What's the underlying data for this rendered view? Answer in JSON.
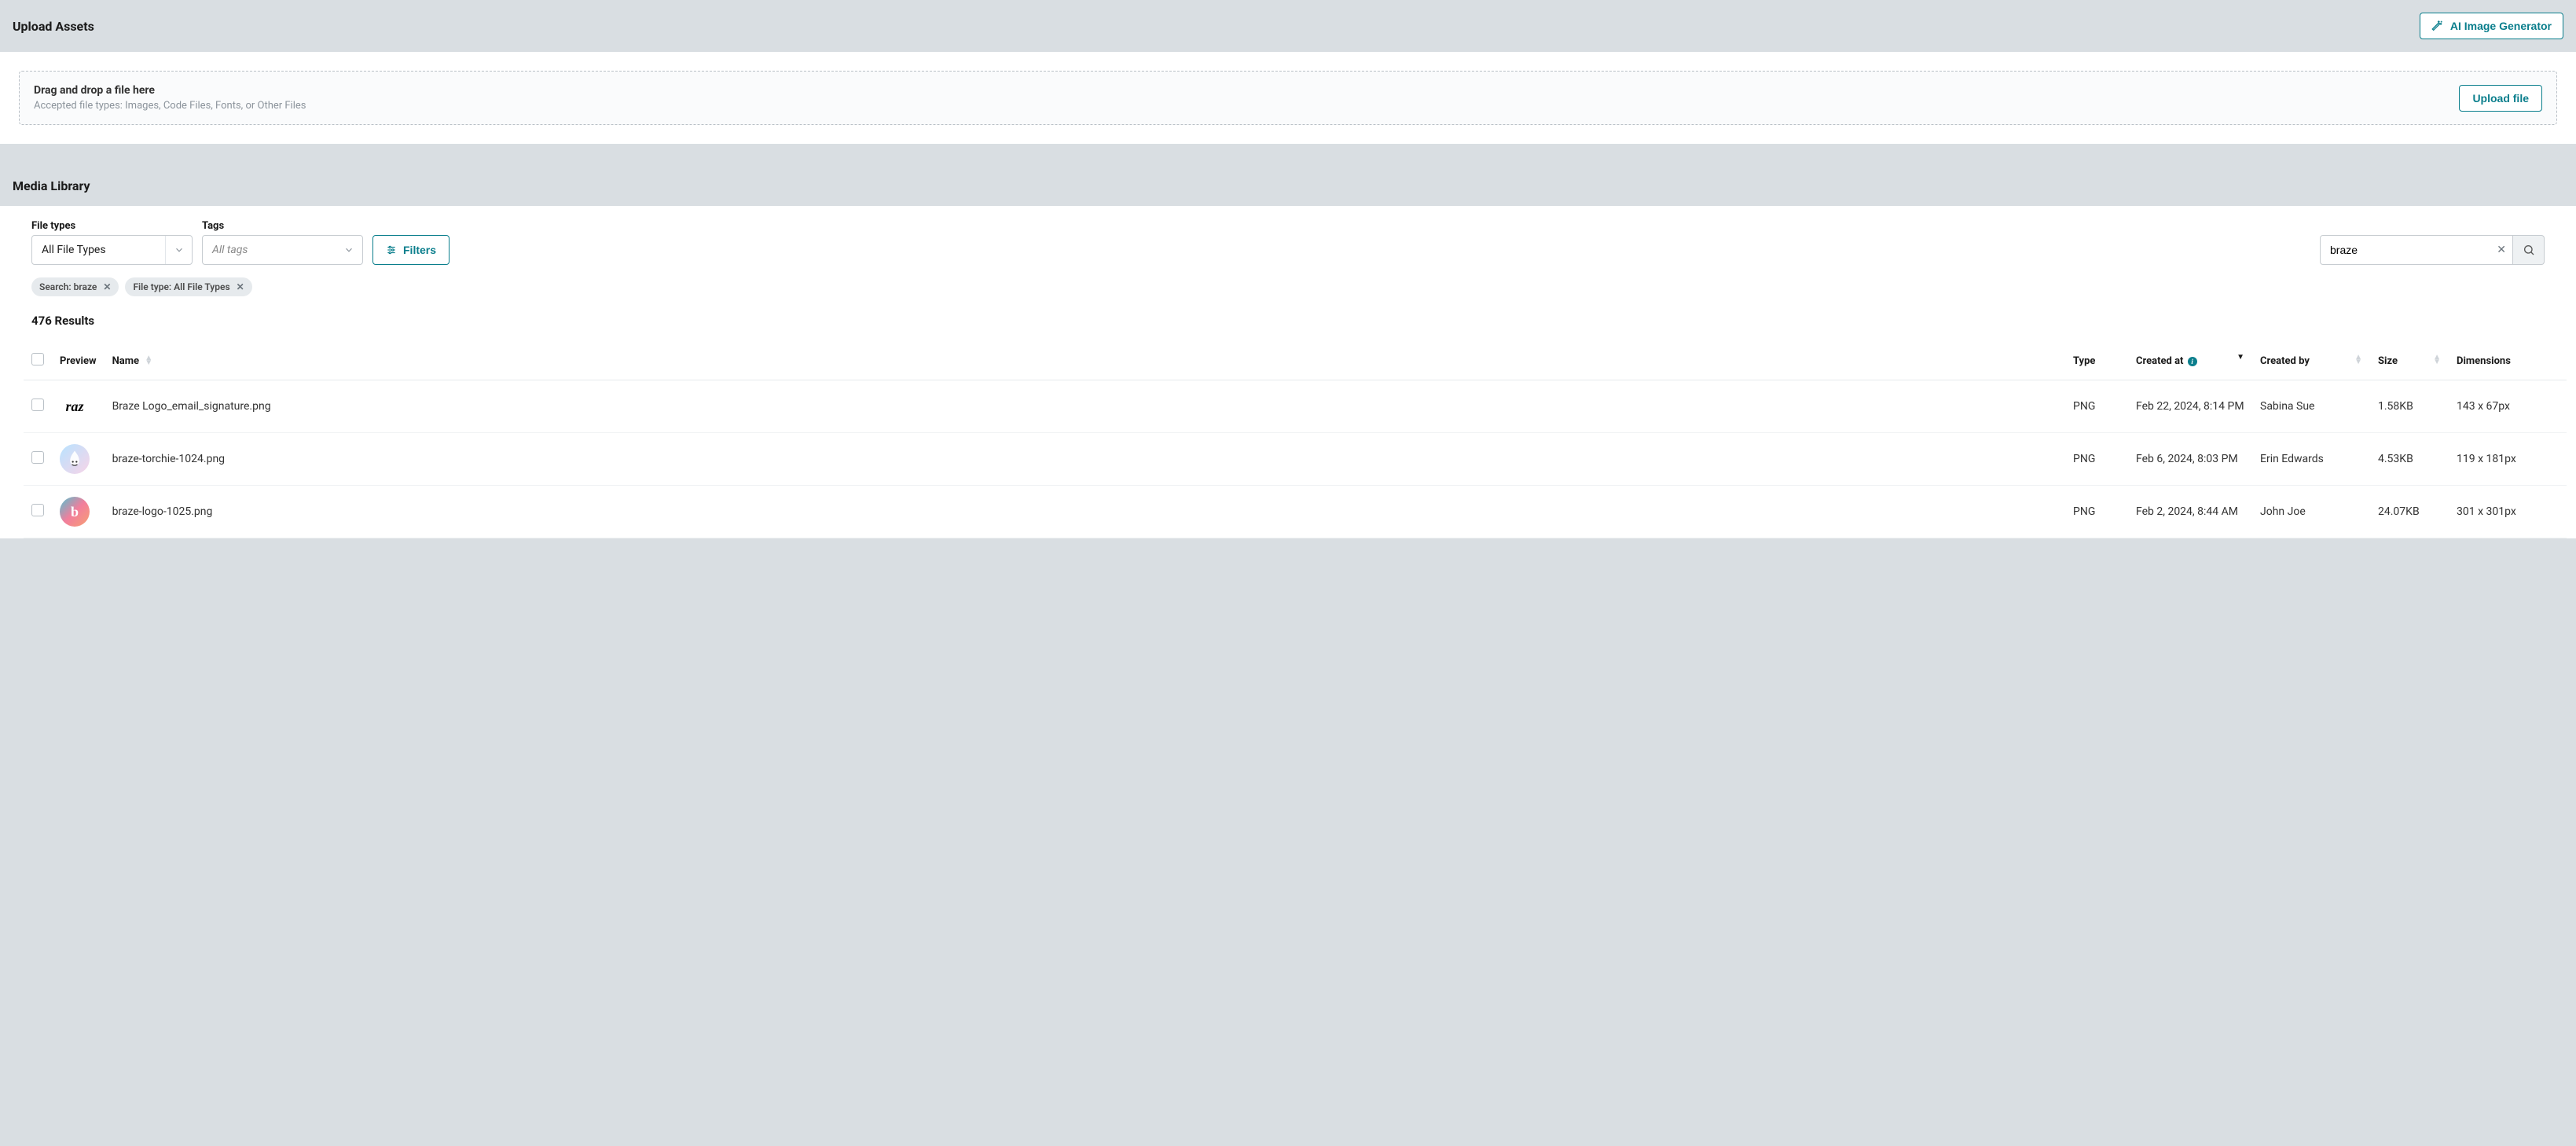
{
  "upload": {
    "title": "Upload Assets",
    "ai_button": "AI Image Generator",
    "dropzone_title": "Drag and drop a file here",
    "dropzone_sub": "Accepted file types: Images, Code Files, Fonts, or Other Files",
    "upload_button": "Upload file"
  },
  "library": {
    "title": "Media Library",
    "filters": {
      "file_types_label": "File types",
      "file_types_value": "All File Types",
      "tags_label": "Tags",
      "tags_placeholder": "All tags",
      "filters_button": "Filters"
    },
    "search": {
      "value": "braze"
    },
    "chips": {
      "search": "Search: braze",
      "filetype": "File type: All File Types"
    },
    "results_count": "476 Results",
    "columns": {
      "preview": "Preview",
      "name": "Name",
      "type": "Type",
      "created_at": "Created at",
      "created_by": "Created by",
      "size": "Size",
      "dimensions": "Dimensions"
    },
    "rows": [
      {
        "name": "Braze Logo_email_signature.png",
        "type": "PNG",
        "created_at": "Feb 22, 2024, 8:14 PM",
        "created_by": "Sabina Sue",
        "size": "1.58KB",
        "dimensions": "143 x 67px",
        "thumb_glyph": "raz"
      },
      {
        "name": "braze-torchie-1024.png",
        "type": "PNG",
        "created_at": "Feb 6, 2024, 8:03 PM",
        "created_by": "Erin Edwards",
        "size": "4.53KB",
        "dimensions": "119 x 181px",
        "thumb_glyph": "🔥"
      },
      {
        "name": "braze-logo-1025.png",
        "type": "PNG",
        "created_at": "Feb 2, 2024, 8:44 AM",
        "created_by": "John Joe",
        "size": "24.07KB",
        "dimensions": "301 x 301px",
        "thumb_glyph": "b"
      }
    ]
  }
}
